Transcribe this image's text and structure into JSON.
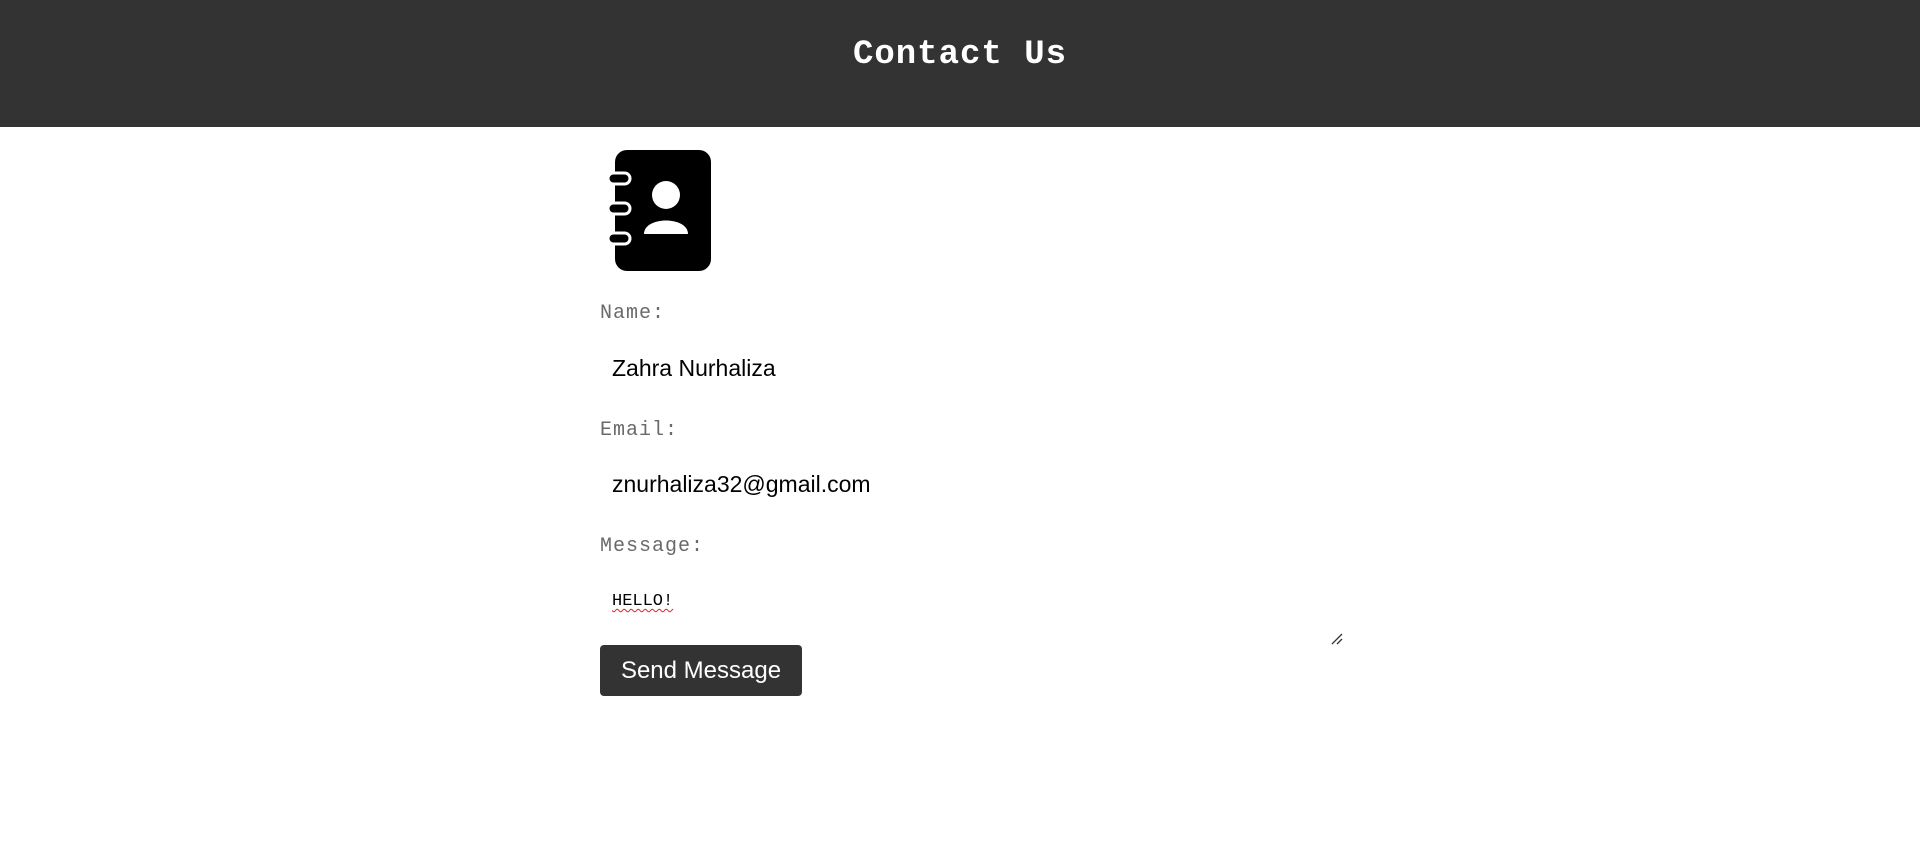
{
  "header": {
    "title": "Contact Us"
  },
  "icon": {
    "name": "contact-book-icon"
  },
  "form": {
    "name_label": "Name:",
    "name_value": "Zahra Nurhaliza",
    "email_label": "Email:",
    "email_value": "znurhaliza32@gmail.com",
    "message_label": "Message:",
    "message_value": "HELLO!",
    "submit_label": "Send Message"
  },
  "colors": {
    "header_bg": "#333333",
    "button_bg": "#333333",
    "label_text": "#6a6a6a"
  }
}
